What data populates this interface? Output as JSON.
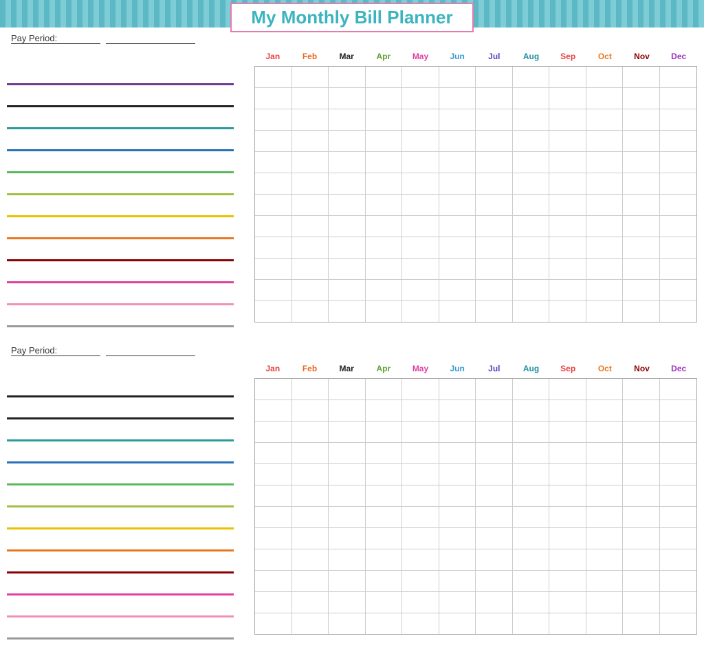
{
  "title": "My Monthly Bill Planner",
  "months": [
    {
      "label": "Jan",
      "class": "mc-jan"
    },
    {
      "label": "Feb",
      "class": "mc-feb"
    },
    {
      "label": "Mar",
      "class": "mc-mar"
    },
    {
      "label": "Apr",
      "class": "mc-apr"
    },
    {
      "label": "May",
      "class": "mc-may"
    },
    {
      "label": "Jun",
      "class": "mc-jun"
    },
    {
      "label": "Jul",
      "class": "mc-jul"
    },
    {
      "label": "Aug",
      "class": "mc-aug"
    },
    {
      "label": "Sep",
      "class": "mc-sep"
    },
    {
      "label": "Oct",
      "class": "mc-oct"
    },
    {
      "label": "Nov",
      "class": "mc-nov"
    },
    {
      "label": "Dec",
      "class": "mc-dec"
    }
  ],
  "payPeriodLabel": "Pay Period:",
  "section1": {
    "lineColors": [
      "lc-purple",
      "lc-black",
      "lc-teal",
      "lc-blue",
      "lc-green",
      "lc-ltgreen",
      "lc-yellow",
      "lc-orange",
      "lc-darkred",
      "lc-pink",
      "lc-ltpink",
      "lc-gray"
    ]
  },
  "section2": {
    "lineColors": [
      "lc-black",
      "lc-black",
      "lc-teal",
      "lc-blue",
      "lc-green",
      "lc-ltgreen",
      "lc-yellow",
      "lc-orange",
      "lc-darkred",
      "lc-pink",
      "lc-ltpink",
      "lc-gray"
    ]
  }
}
